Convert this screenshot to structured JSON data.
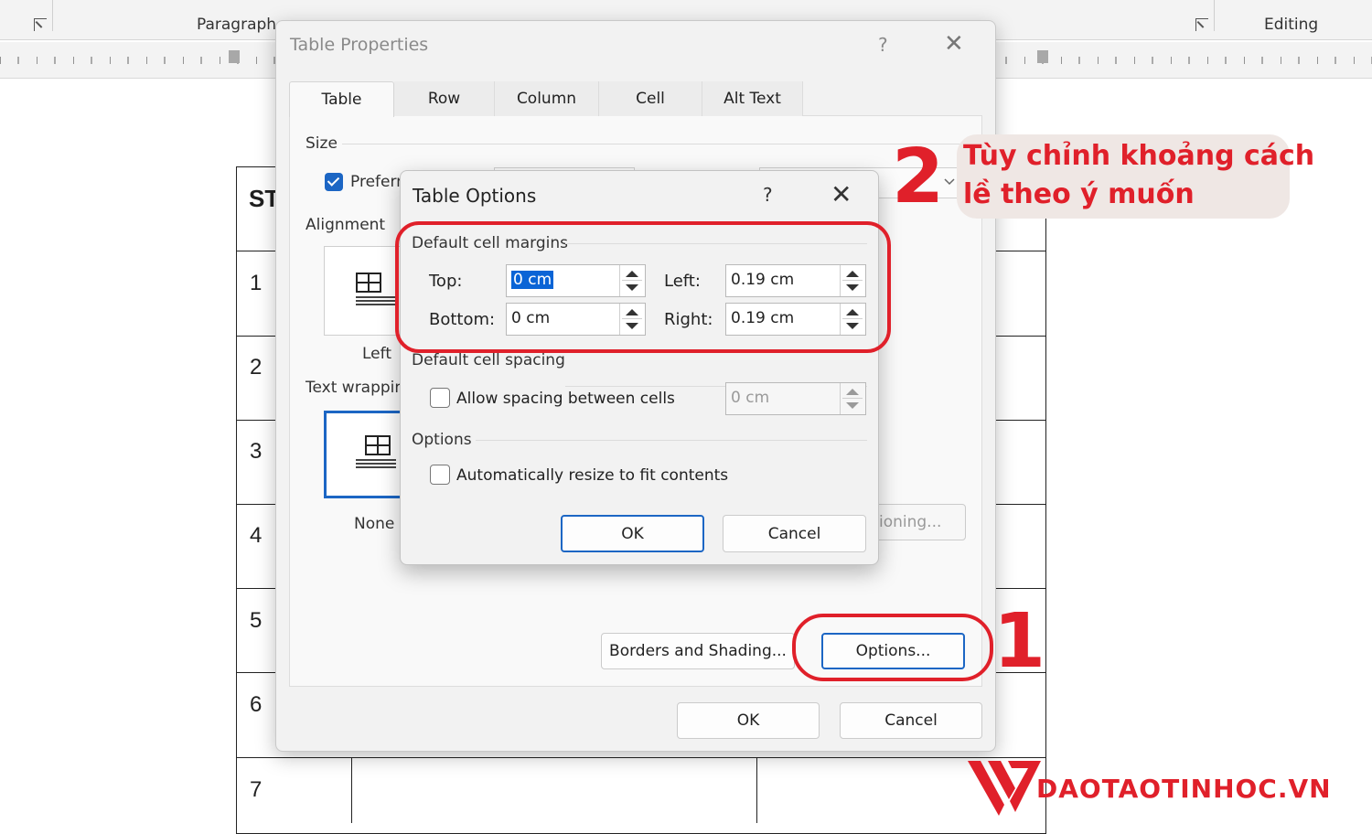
{
  "ribbon": {
    "paragraph_label": "Paragraph",
    "editing_label": "Editing"
  },
  "document": {
    "header_text": "ST",
    "row_numbers": [
      "1",
      "2",
      "3",
      "4",
      "5",
      "6",
      "7"
    ]
  },
  "table_properties": {
    "title": "Table Properties",
    "help": "?",
    "close": "✕",
    "tabs": [
      {
        "label": "Table",
        "active": true
      },
      {
        "label": "Row",
        "active": false
      },
      {
        "label": "Column",
        "active": false
      },
      {
        "label": "Cell",
        "active": false
      },
      {
        "label": "Alt Text",
        "active": false
      }
    ],
    "size_label": "Size",
    "preferred_label": "Preferr",
    "alignment_label": "Alignment",
    "align_left_label": "Left",
    "text_wrapping_label": "Text wrappin",
    "wrap_none_label": "None",
    "positioning_label": "ioning...",
    "borders_button": "Borders and Shading...",
    "options_button": "Options...",
    "ok_button": "OK",
    "cancel_button": "Cancel"
  },
  "table_options": {
    "title": "Table Options",
    "help": "?",
    "close": "✕",
    "margins_group": "Default cell margins",
    "top_label": "Top:",
    "top_value": "0 cm",
    "bottom_label": "Bottom:",
    "bottom_value": "0 cm",
    "left_label": "Left:",
    "left_value": "0.19 cm",
    "right_label": "Right:",
    "right_value": "0.19 cm",
    "spacing_group": "Default cell spacing",
    "allow_spacing_label": "Allow spacing between cells",
    "allow_spacing_checked": false,
    "spacing_value": "0 cm",
    "options_group": "Options",
    "auto_resize_label": "Automatically resize to fit contents",
    "auto_resize_checked": false,
    "ok_button": "OK",
    "cancel_button": "Cancel"
  },
  "annotations": {
    "step1_number": "1",
    "step2_number": "2",
    "step2_line1": "Tùy chỉnh khoảng cách",
    "step2_line2": "lề theo ý muốn",
    "accent_color": "#e0202a"
  },
  "watermark": {
    "text": "DAOTAOTINHOC.VN"
  }
}
